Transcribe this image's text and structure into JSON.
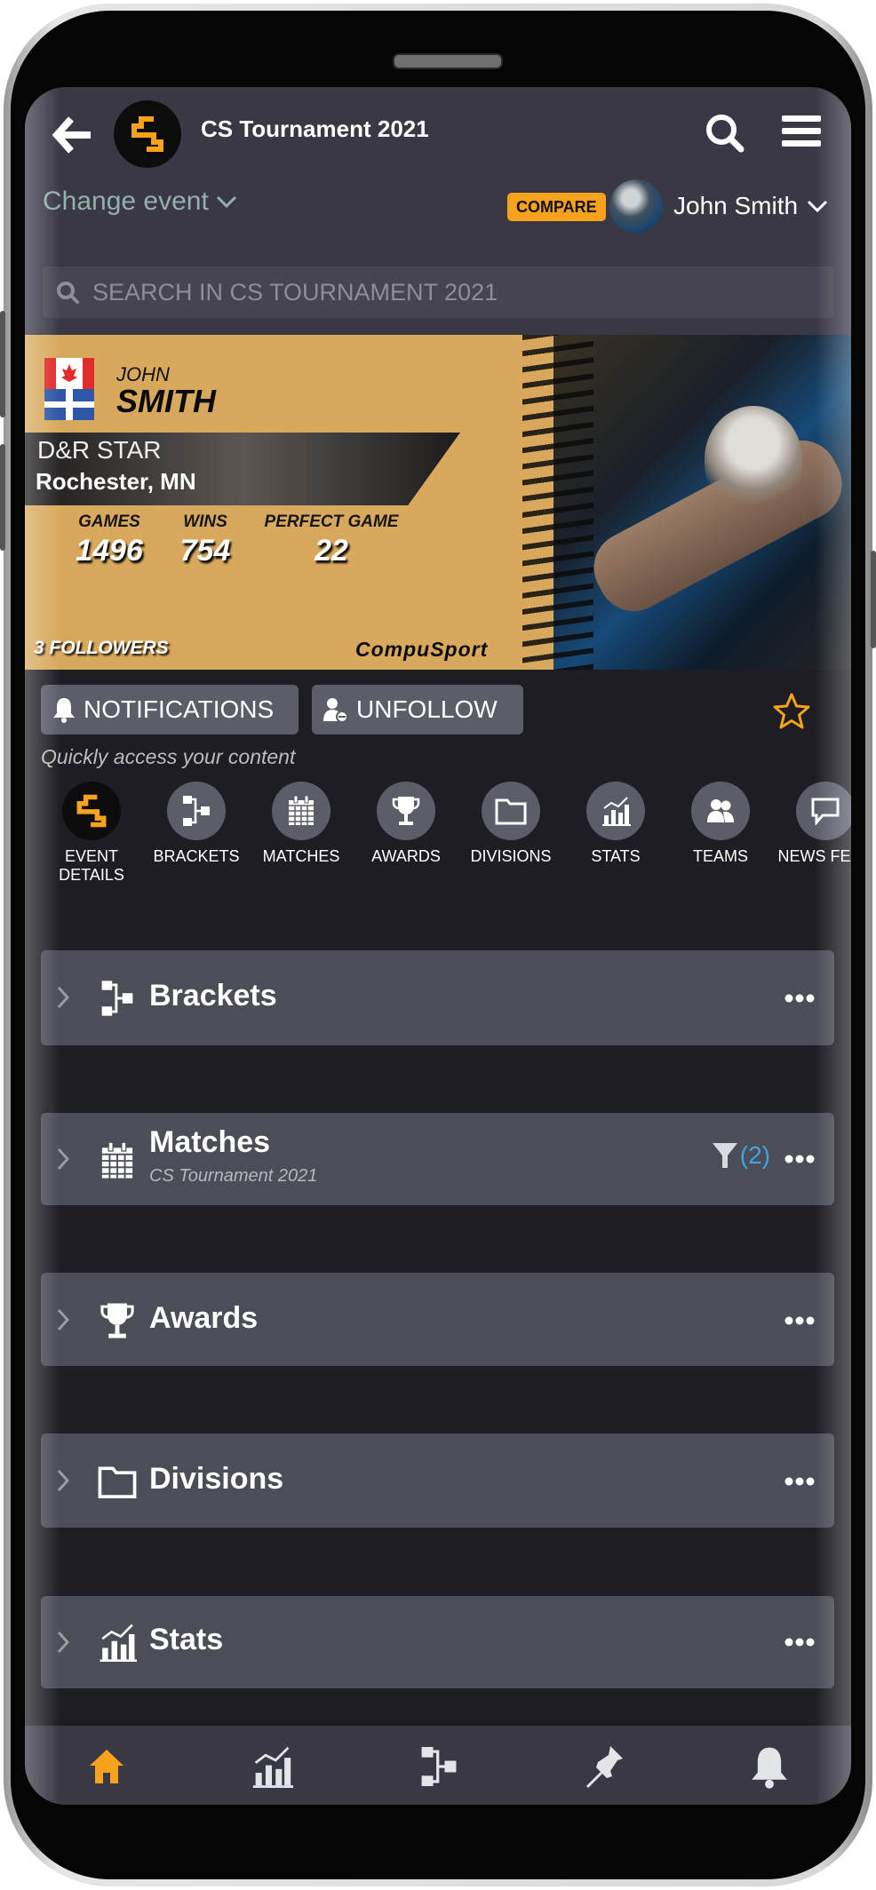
{
  "header": {
    "title": "CS Tournament 2021",
    "back_icon": "arrow-left-icon",
    "search_icon": "search-icon",
    "menu_icon": "hamburger-menu-icon"
  },
  "event_bar": {
    "change_event_label": "Change event",
    "compare_label": "COMPARE",
    "user_name": "John Smith"
  },
  "search": {
    "placeholder": "SEARCH IN CS TOURNAMENT 2021"
  },
  "profile_banner": {
    "first_name": "JOHN",
    "last_name": "SMITH",
    "team": "D&R STAR",
    "location": "Rochester, MN",
    "stats": [
      {
        "label": "GAMES",
        "value": "1496"
      },
      {
        "label": "WINS",
        "value": "754"
      },
      {
        "label": "PERFECT GAME",
        "value": "22"
      }
    ],
    "followers": "3 FOLLOWERS",
    "brand": "CompuSport"
  },
  "actions": {
    "notifications_label": "NOTIFICATIONS",
    "unfollow_label": "UNFOLLOW",
    "favorite_icon": "star-outline-icon"
  },
  "quick_access": {
    "caption": "Quickly access your content",
    "items": [
      {
        "label": "EVENT DETAILS",
        "icon": "cs-logo-icon"
      },
      {
        "label": "BRACKETS",
        "icon": "bracket-icon"
      },
      {
        "label": "MATCHES",
        "icon": "calendar-icon"
      },
      {
        "label": "AWARDS",
        "icon": "trophy-icon"
      },
      {
        "label": "DIVISIONS",
        "icon": "folder-icon"
      },
      {
        "label": "STATS",
        "icon": "stats-chart-icon"
      },
      {
        "label": "TEAMS",
        "icon": "users-icon"
      },
      {
        "label": "NEWS FEED",
        "icon": "speech-bubble-icon"
      }
    ]
  },
  "sections": [
    {
      "title": "Brackets",
      "icon": "bracket-icon"
    },
    {
      "title": "Matches",
      "subtitle": "CS Tournament 2021",
      "icon": "calendar-icon",
      "filter_count": "(2)"
    },
    {
      "title": "Awards",
      "icon": "trophy-icon"
    },
    {
      "title": "Divisions",
      "icon": "folder-icon"
    },
    {
      "title": "Stats",
      "icon": "stats-chart-icon"
    }
  ],
  "bottom_nav": {
    "items": [
      {
        "name": "home",
        "icon": "home-icon",
        "active": true
      },
      {
        "name": "stats",
        "icon": "stats-chart-icon",
        "active": false
      },
      {
        "name": "brackets",
        "icon": "bracket-icon",
        "active": false
      },
      {
        "name": "pinned",
        "icon": "pin-icon",
        "active": false
      },
      {
        "name": "notifications",
        "icon": "bell-icon",
        "active": false
      }
    ]
  },
  "colors": {
    "accent": "#f7a21c",
    "filter_count": "#3fa4e0",
    "card_bg": "#4b4d57",
    "header_bg": "#3a3845",
    "page_bg": "#1e1d23"
  }
}
